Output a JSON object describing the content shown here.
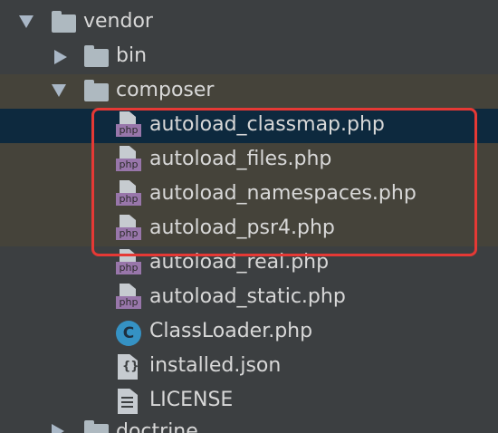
{
  "tree": {
    "vendor": "vendor",
    "bin": "bin",
    "composer": "composer",
    "files": [
      {
        "label": "autoload_classmap.php",
        "type": "php"
      },
      {
        "label": "autoload_files.php",
        "type": "php"
      },
      {
        "label": "autoload_namespaces.php",
        "type": "php"
      },
      {
        "label": "autoload_psr4.php",
        "type": "php"
      },
      {
        "label": "autoload_real.php",
        "type": "php"
      },
      {
        "label": "autoload_static.php",
        "type": "php"
      },
      {
        "label": "ClassLoader.php",
        "type": "class"
      },
      {
        "label": "installed.json",
        "type": "json"
      },
      {
        "label": "LICENSE",
        "type": "text"
      }
    ],
    "doctrine": "doctrine"
  },
  "icons": {
    "php_tag": "php",
    "class_letter": "C",
    "json_glyph": "{}"
  },
  "colors": {
    "background": "#3c3f41",
    "selected_row": "#0d293e",
    "highlight_border": "#e53935",
    "php_badge": "#9876aa",
    "class_badge": "#3592c4"
  }
}
